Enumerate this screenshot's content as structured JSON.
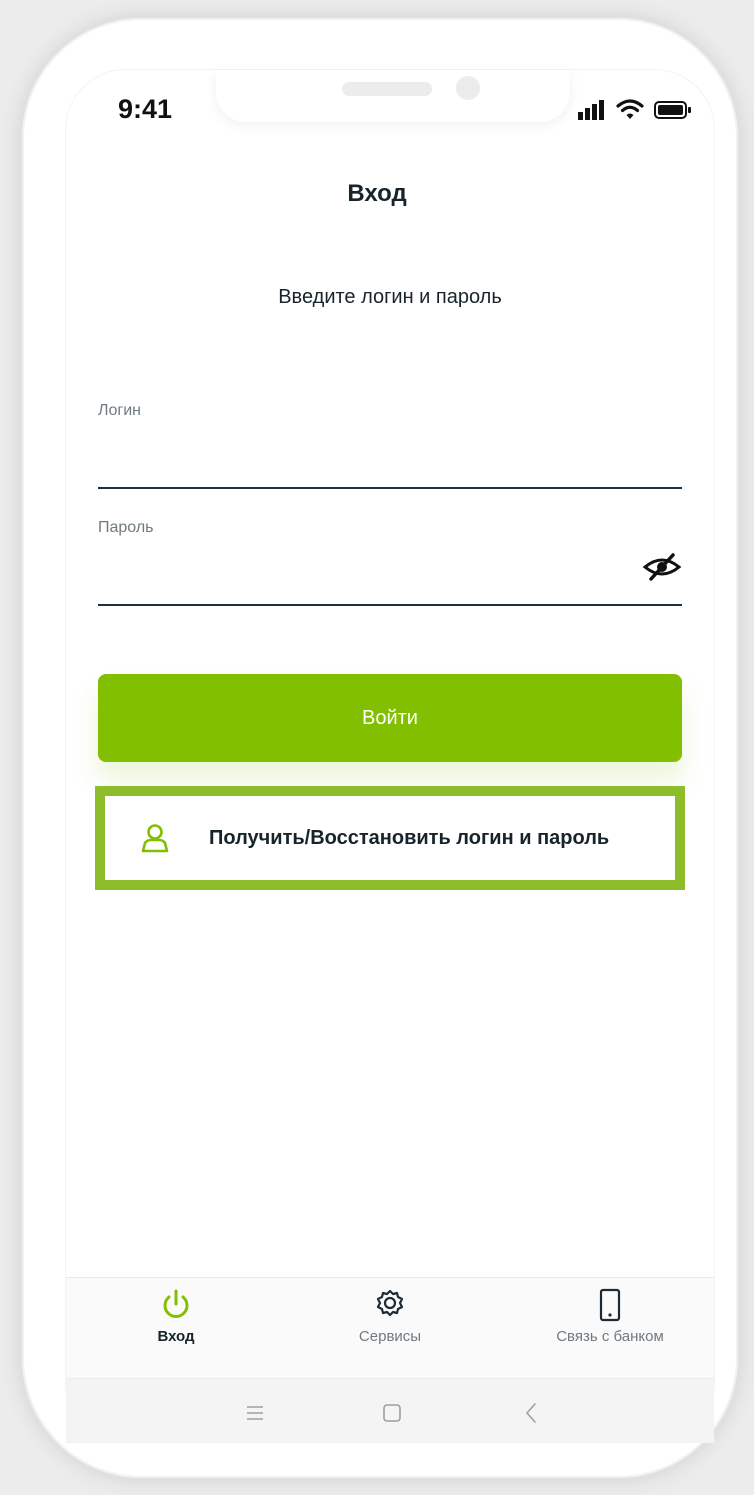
{
  "status_bar": {
    "time": "9:41"
  },
  "header": {
    "title": "Вход"
  },
  "form": {
    "instruction": "Введите логин и пароль",
    "login_label": "Логин",
    "login_value": "",
    "password_label": "Пароль",
    "password_value": "",
    "submit_label": "Войти"
  },
  "recover": {
    "label": "Получить/Восстановить логин и пароль"
  },
  "tabs": [
    {
      "label": "Вход",
      "icon": "power-icon",
      "active": true
    },
    {
      "label": "Сервисы",
      "icon": "gear-icon",
      "active": false
    },
    {
      "label": "Связь с банком",
      "icon": "phone-icon",
      "active": false
    }
  ],
  "colors": {
    "accent": "#82bf00",
    "highlight_border": "#8dbd2b",
    "text_primary": "#17242b",
    "text_secondary": "#6f7a80"
  }
}
